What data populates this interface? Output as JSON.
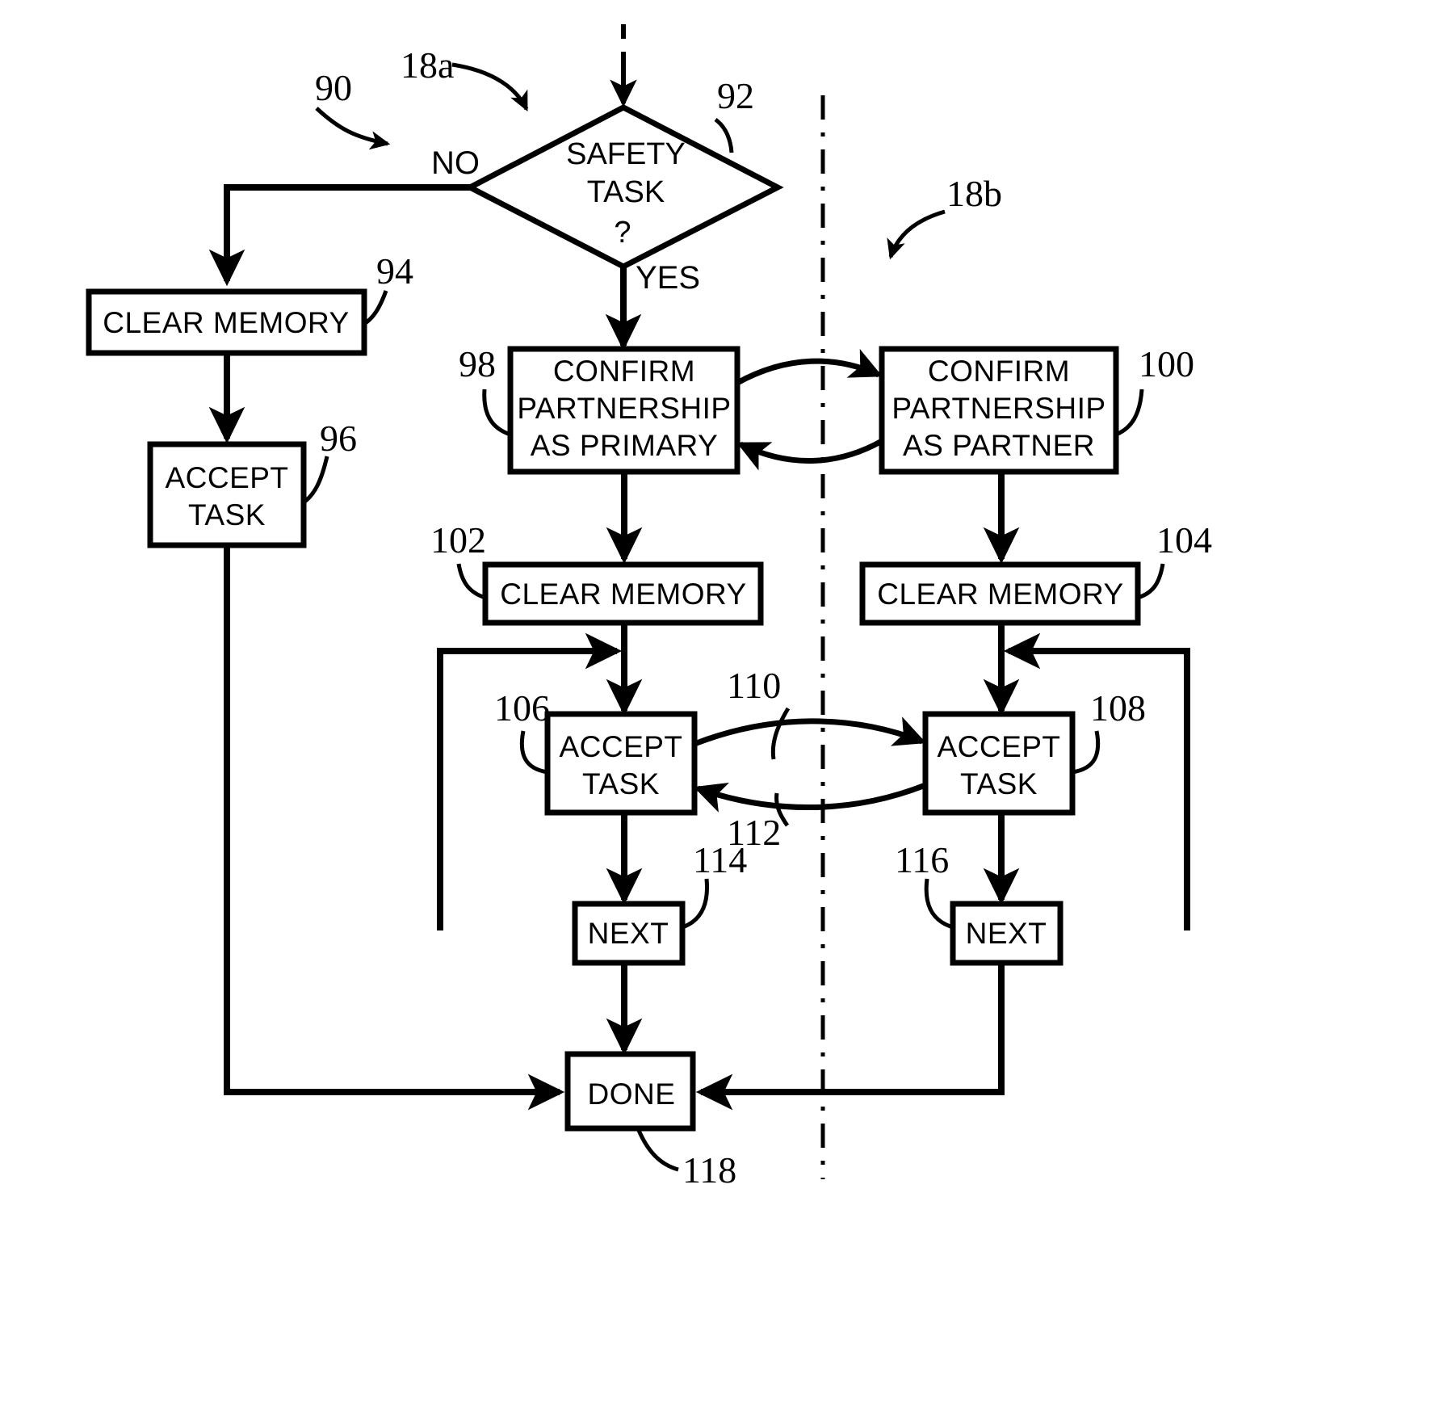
{
  "figure": {
    "type": "patent-flowchart",
    "background_color": "#ffffff",
    "line_color": "#000000"
  },
  "nodes": {
    "safety_task": {
      "line1": "SAFETY",
      "line2": "TASK",
      "line3": "?",
      "ref": "92"
    },
    "clear_memory_left": {
      "label": "CLEAR  MEMORY",
      "ref": "94"
    },
    "accept_task_left": {
      "line1": "ACCEPT",
      "line2": "TASK",
      "ref": "96"
    },
    "confirm_primary": {
      "line1": "CONFIRM",
      "line2": "PARTNERSHIP",
      "line3": "AS  PRIMARY",
      "ref": "98"
    },
    "confirm_partner": {
      "line1": "CONFIRM",
      "line2": "PARTNERSHIP",
      "line3": "AS  PARTNER",
      "ref": "100"
    },
    "clear_memory_center": {
      "label": "CLEAR  MEMORY",
      "ref": "102"
    },
    "clear_memory_right": {
      "label": "CLEAR  MEMORY",
      "ref": "104"
    },
    "accept_task_center": {
      "line1": "ACCEPT",
      "line2": "TASK",
      "ref": "106"
    },
    "accept_task_right": {
      "line1": "ACCEPT",
      "line2": "TASK",
      "ref": "108"
    },
    "next_center": {
      "label": "NEXT",
      "ref": "114"
    },
    "next_right": {
      "label": "NEXT",
      "ref": "116"
    },
    "done": {
      "label": "DONE",
      "ref": "118"
    }
  },
  "branch_labels": {
    "no": "NO",
    "yes": "YES"
  },
  "callouts": {
    "flow_ref": "90",
    "lane_left": "18a",
    "lane_right": "18b",
    "arrow_primary_to_partner": "110",
    "arrow_partner_to_primary": "112"
  }
}
